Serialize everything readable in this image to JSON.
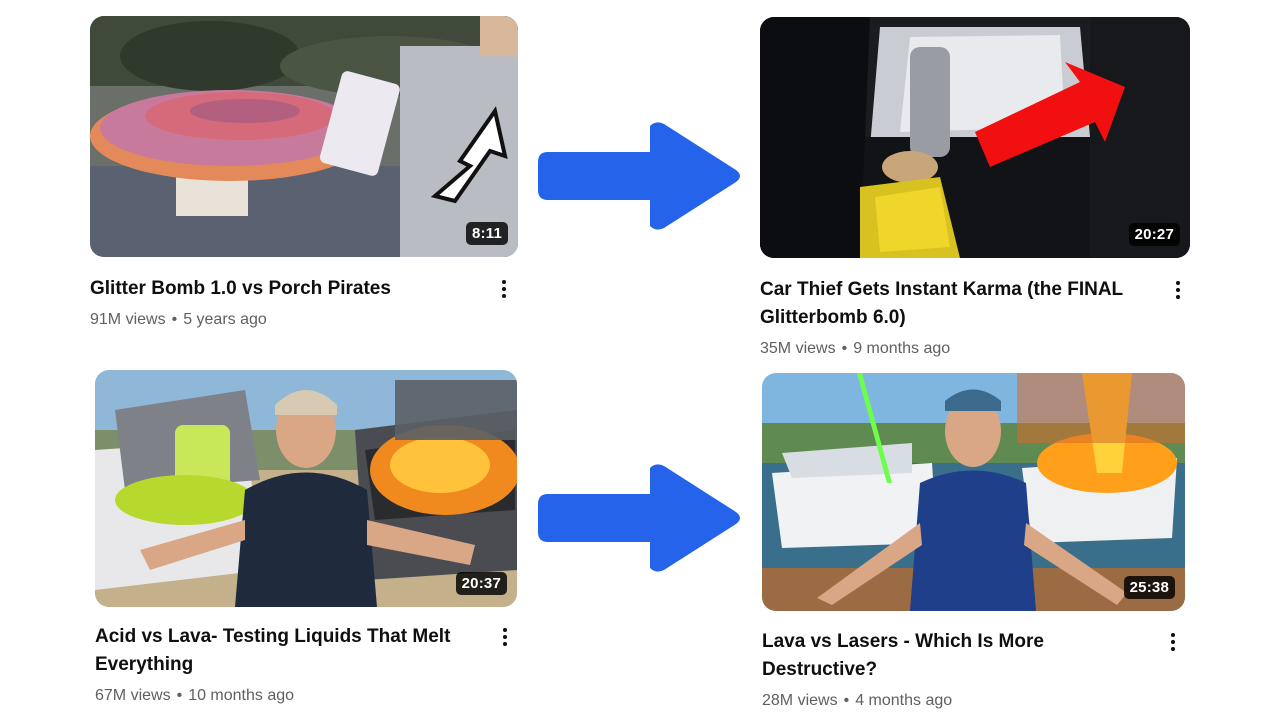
{
  "videos": [
    {
      "title": "Glitter Bomb 1.0 vs Porch Pirates",
      "views": "91M views",
      "age": "5 years ago",
      "duration": "8:11"
    },
    {
      "title": "Car Thief Gets Instant Karma (the FINAL Glitterbomb 6.0)",
      "views": "35M views",
      "age": "9 months ago",
      "duration": "20:27"
    },
    {
      "title": "Acid vs Lava- Testing Liquids That Melt Everything",
      "views": "67M views",
      "age": "10 months ago",
      "duration": "20:37"
    },
    {
      "title": "Lava vs Lasers - Which Is More Destructive?",
      "views": "28M views",
      "age": "4 months ago",
      "duration": "25:38"
    }
  ],
  "separator": "•",
  "icons": {
    "menu": "more-vert-icon",
    "arrow": "right-arrow-icon"
  },
  "colors": {
    "arrow": "#2563eb",
    "duration_bg": "#000000",
    "title": "#0f0f0f",
    "meta": "#606060"
  }
}
